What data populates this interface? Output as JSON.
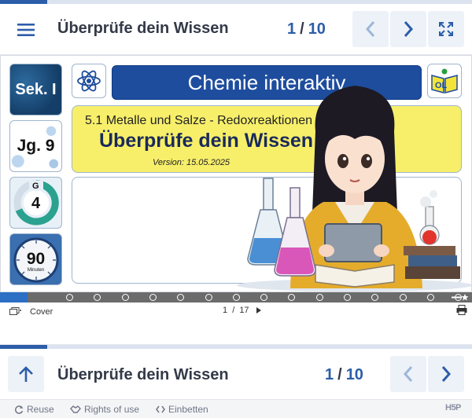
{
  "top_nav": {
    "title": "Überprüfe dein Wissen",
    "current": "1",
    "separator": "/",
    "total": "10",
    "progress_fraction": 0.1,
    "menu_icon": "hamburger-icon",
    "prev_icon": "chevron-left-icon",
    "next_icon": "chevron-right-icon",
    "fullscreen_icon": "fullscreen-icon"
  },
  "slide": {
    "badge_level": "Sek. I",
    "badge_grade": "Jg. 9",
    "badge_g_letter": "G",
    "badge_g_value": "4",
    "badge_minutes_value": "90",
    "badge_minutes_unit": "Minuten",
    "banner_title": "Chemie interaktiv",
    "logo_text": "OL",
    "subtitle": "5.1 Metalle und Salze - Redoxreaktionen",
    "heading": "Überprüfe dein Wissen",
    "version": "Version: 15.05.2025"
  },
  "slide_progress": {
    "current_fraction": 0.0588,
    "dot_count": 15,
    "fill_color": "#2c6fc4",
    "track_color": "#6b6b6b"
  },
  "pager": {
    "cover_label": "Cover",
    "page_current": "1",
    "page_separator": "/",
    "page_total": "17"
  },
  "bottom_nav": {
    "title": "Überprüfe dein Wissen",
    "current": "1",
    "separator": "/",
    "total": "10",
    "progress_fraction": 0.1
  },
  "footer": {
    "reuse_label": "Reuse",
    "rights_label": "Rights of use",
    "embed_label": "Einbetten",
    "brand": "H5P"
  },
  "colors": {
    "accent": "#2c5da9",
    "nav_button_bg": "#edf2f8",
    "banner_bg": "#1e4d9e",
    "card_yellow": "#f7ef6a"
  }
}
